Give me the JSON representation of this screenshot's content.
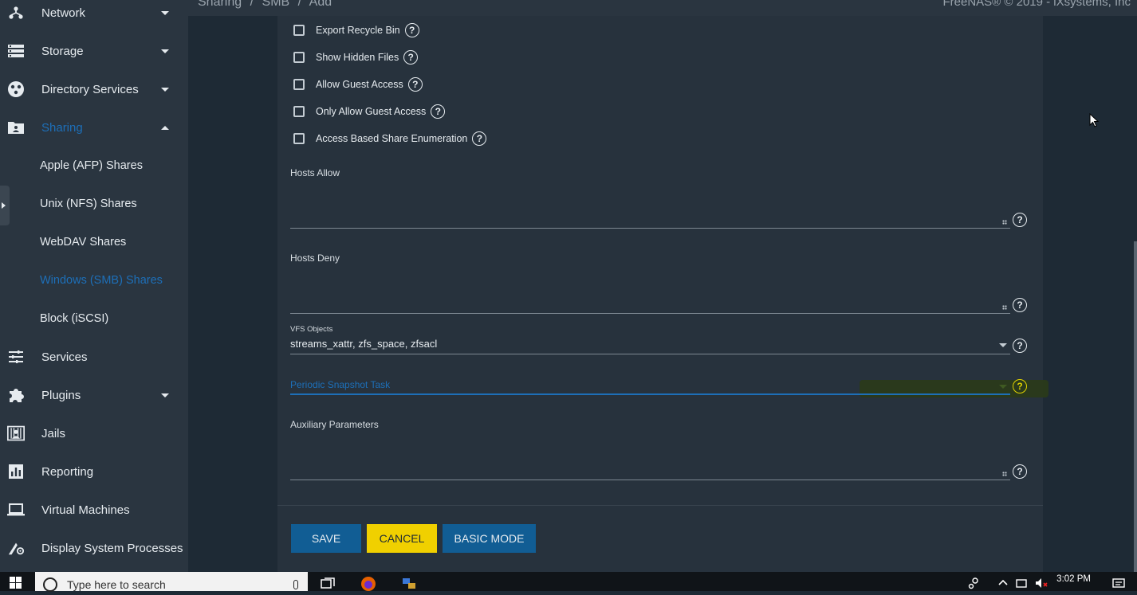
{
  "breadcrumb": [
    "Sharing",
    "/",
    "SMB",
    "/",
    "Add"
  ],
  "copyright": "FreeNAS® © 2019 - iXsystems, Inc",
  "sidebar": {
    "items": [
      {
        "label": "Network",
        "icon": "network-icon",
        "caret": "down"
      },
      {
        "label": "Storage",
        "icon": "storage-icon",
        "caret": "down"
      },
      {
        "label": "Directory Services",
        "icon": "directory-services-icon",
        "caret": "down"
      },
      {
        "label": "Sharing",
        "icon": "sharing-icon",
        "caret": "up",
        "active": true
      },
      {
        "label": "Services",
        "icon": "services-icon"
      },
      {
        "label": "Plugins",
        "icon": "plugins-icon",
        "caret": "down"
      },
      {
        "label": "Jails",
        "icon": "jails-icon"
      },
      {
        "label": "Reporting",
        "icon": "reporting-icon"
      },
      {
        "label": "Virtual Machines",
        "icon": "virtual-machines-icon"
      },
      {
        "label": "Display System Processes",
        "icon": "system-processes-icon"
      }
    ],
    "sharing_sub": [
      {
        "label": "Apple (AFP) Shares"
      },
      {
        "label": "Unix (NFS) Shares"
      },
      {
        "label": "WebDAV Shares"
      },
      {
        "label": "Windows (SMB) Shares",
        "active": true
      },
      {
        "label": "Block (iSCSI)"
      }
    ]
  },
  "form": {
    "checkboxes": [
      {
        "label": "Export Recycle Bin",
        "checked": false
      },
      {
        "label": "Show Hidden Files",
        "checked": false
      },
      {
        "label": "Allow Guest Access",
        "checked": false
      },
      {
        "label": "Only Allow Guest Access",
        "checked": false
      },
      {
        "label": "Access Based Share Enumeration",
        "checked": false
      }
    ],
    "hosts_allow_label": "Hosts Allow",
    "hosts_allow_value": "",
    "hosts_deny_label": "Hosts Deny",
    "hosts_deny_value": "",
    "vfs_label": "VFS Objects",
    "vfs_value": "streams_xattr, zfs_space, zfsacl",
    "snapshot_label": "Periodic Snapshot Task",
    "aux_label": "Auxiliary Parameters",
    "aux_value": "",
    "help_glyph": "?"
  },
  "buttons": {
    "save": "SAVE",
    "cancel": "CANCEL",
    "basic": "BASIC MODE"
  },
  "taskbar": {
    "search_placeholder": "Type here to search",
    "time": "3:02 PM"
  },
  "colors": {
    "accent": "#1d6fb8",
    "save": "#115d94",
    "cancel": "#f0d000",
    "background": "#1e2a35",
    "panel": "#27323d",
    "sidebar": "#2a3540"
  }
}
